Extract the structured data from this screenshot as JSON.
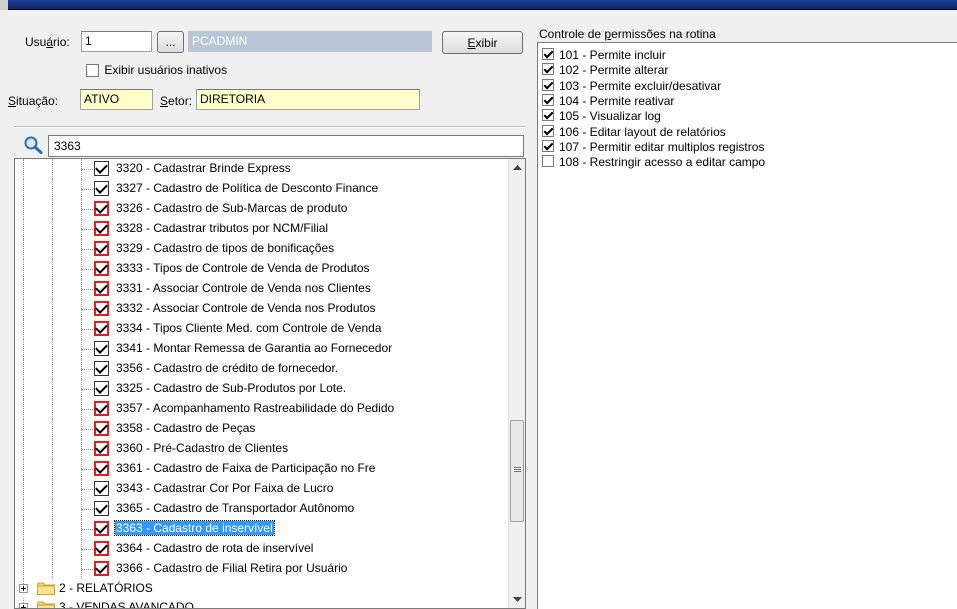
{
  "user_section": {
    "usuario_label_prefix": "Usu",
    "usuario_label_underline": "á",
    "usuario_label_suffix": "rio:",
    "usuario_code": "1",
    "lookup_button": "...",
    "usuario_name": "PCADMIN",
    "exibir_button_u": "E",
    "exibir_button_rest": "xibir",
    "show_inactive_label": "Exibir usuários inativos",
    "situacao_label_u": "S",
    "situacao_label_rest": "ituação:",
    "situacao_value": "ATIVO",
    "setor_label_u": "S",
    "setor_label_rest": "etor:",
    "setor_value": "DIRETORIA"
  },
  "search": {
    "value": "3363"
  },
  "tree": {
    "items": [
      {
        "label": "3320 - Cadastrar Brinde Express",
        "checked": true,
        "red": false
      },
      {
        "label": "3327 - Cadastro de Política de Desconto Finance",
        "checked": true,
        "red": false
      },
      {
        "label": "3326 - Cadastro de Sub-Marcas de produto",
        "checked": true,
        "red": true
      },
      {
        "label": "3328 - Cadastrar tributos por NCM/Filial",
        "checked": true,
        "red": true
      },
      {
        "label": "3329 - Cadastro de tipos de bonificações",
        "checked": true,
        "red": true
      },
      {
        "label": "3333 - Tipos de Controle de Venda de Produtos",
        "checked": true,
        "red": true
      },
      {
        "label": "3331 - Associar Controle de Venda nos Clientes",
        "checked": true,
        "red": true
      },
      {
        "label": "3332 - Associar Controle de Venda nos Produtos",
        "checked": true,
        "red": true
      },
      {
        "label": "3334 - Tipos Cliente Med. com Controle de Venda",
        "checked": true,
        "red": true
      },
      {
        "label": "3341 - Montar Remessa de Garantia ao Fornecedor",
        "checked": true,
        "red": false
      },
      {
        "label": "3356 - Cadastro de crédito de fornecedor.",
        "checked": true,
        "red": false
      },
      {
        "label": "3325 - Cadastro de Sub-Produtos por Lote.",
        "checked": true,
        "red": false
      },
      {
        "label": "3357 - Acompanhamento Rastreabilidade do Pedido",
        "checked": true,
        "red": true
      },
      {
        "label": "3358 - Cadastro de Peças",
        "checked": true,
        "red": true
      },
      {
        "label": "3360 - Pré-Cadastro de Clientes",
        "checked": true,
        "red": true
      },
      {
        "label": "3361 - Cadastro de Faixa de Participação no Fre",
        "checked": true,
        "red": true
      },
      {
        "label": "3343 - Cadastrar Cor Por Faixa de Lucro",
        "checked": true,
        "red": false
      },
      {
        "label": "3365 - Cadastro de Transportador Autônomo",
        "checked": true,
        "red": false
      },
      {
        "label": "3363 - Cadastro de inservível",
        "checked": true,
        "red": true,
        "selected": true
      },
      {
        "label": "3364 - Cadastro de rota de inservível",
        "checked": true,
        "red": true
      },
      {
        "label": "3366 - Cadastro de Filial Retira por Usuário",
        "checked": true,
        "red": true
      }
    ],
    "folders": [
      {
        "label": "2 - RELATÓRIOS"
      },
      {
        "label": "3 - VENDAS AVANÇADO"
      }
    ]
  },
  "permissions": {
    "title_prefix": "Controle de ",
    "title_underline": "p",
    "title_suffix": "ermissões na rotina",
    "items": [
      {
        "label": "101 - Permite incluir",
        "checked": true
      },
      {
        "label": "102 - Permite alterar",
        "checked": true
      },
      {
        "label": "103 - Permite excluir/desativar",
        "checked": true
      },
      {
        "label": "104 - Permite reativar",
        "checked": true
      },
      {
        "label": "105 - Visualizar log",
        "checked": true
      },
      {
        "label": "106 - Editar layout de relatórios",
        "checked": true
      },
      {
        "label": "107 - Permitir editar multiplos registros",
        "checked": true
      },
      {
        "label": "108 - Restringir acesso a editar campo",
        "checked": false
      }
    ]
  },
  "colors": {
    "selection": "#3399ff",
    "highlight_field": "#ffffcc",
    "changed_checkbox_border": "#e02020",
    "titlebar": "#0a246a"
  }
}
